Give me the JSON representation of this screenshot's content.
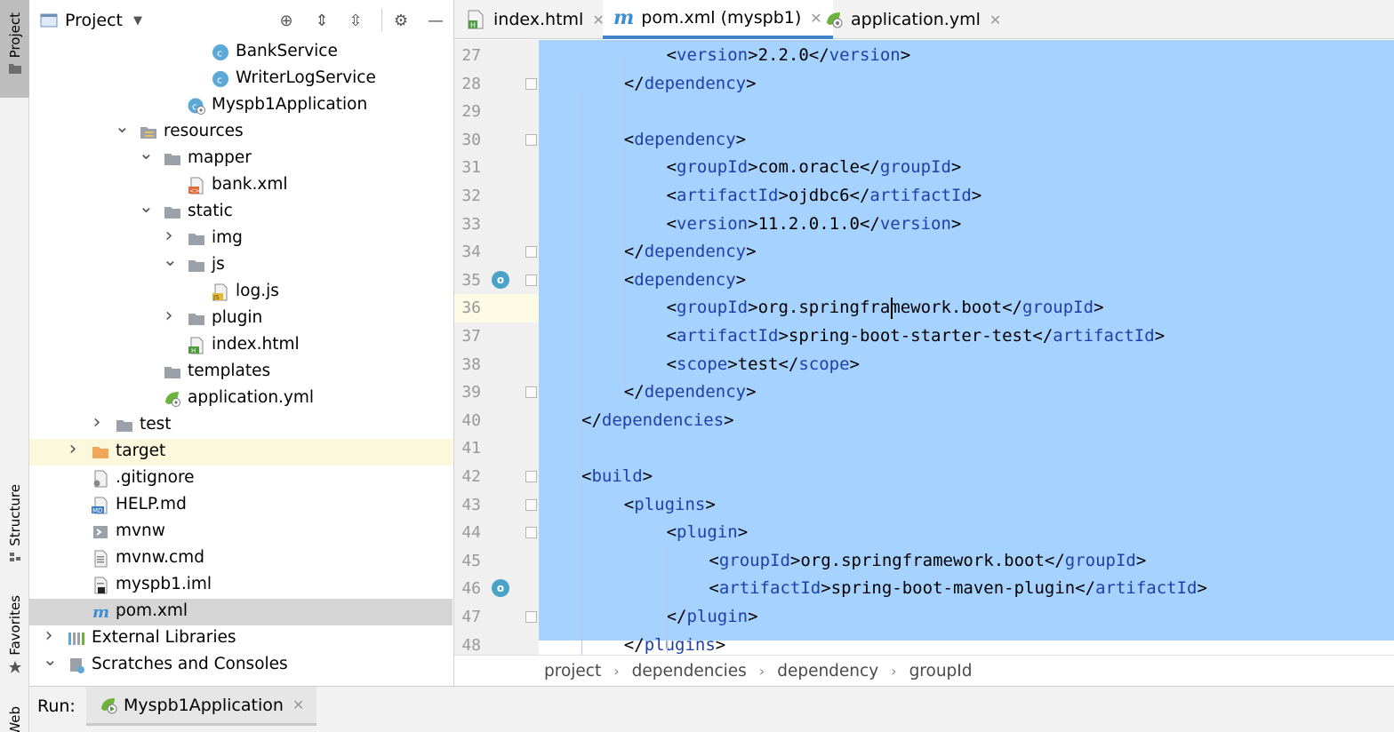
{
  "side_tools": {
    "project": "Project",
    "structure": "Structure",
    "favorites": "Favorites",
    "web": "Web"
  },
  "project_panel": {
    "title": "Project",
    "tree": [
      {
        "label": "BankService",
        "icon": "class-icon",
        "depth": 7,
        "chevron": "none"
      },
      {
        "label": "WriterLogService",
        "icon": "class-icon",
        "depth": 7,
        "chevron": "none"
      },
      {
        "label": "Myspb1Application",
        "icon": "spring-boot-class-icon",
        "depth": 6,
        "chevron": "none"
      },
      {
        "label": "resources",
        "icon": "resources-folder-icon",
        "depth": 4,
        "chevron": "down"
      },
      {
        "label": "mapper",
        "icon": "folder-icon",
        "depth": 5,
        "chevron": "down"
      },
      {
        "label": "bank.xml",
        "icon": "xml-file-icon",
        "depth": 6,
        "chevron": "none"
      },
      {
        "label": "static",
        "icon": "folder-icon",
        "depth": 5,
        "chevron": "down"
      },
      {
        "label": "img",
        "icon": "folder-icon",
        "depth": 6,
        "chevron": "right"
      },
      {
        "label": "js",
        "icon": "folder-icon",
        "depth": 6,
        "chevron": "down"
      },
      {
        "label": "log.js",
        "icon": "js-file-icon",
        "depth": 7,
        "chevron": "none"
      },
      {
        "label": "plugin",
        "icon": "folder-icon",
        "depth": 6,
        "chevron": "right"
      },
      {
        "label": "index.html",
        "icon": "html-file-icon",
        "depth": 6,
        "chevron": "none"
      },
      {
        "label": "templates",
        "icon": "folder-icon",
        "depth": 5,
        "chevron": "none"
      },
      {
        "label": "application.yml",
        "icon": "spring-config-icon",
        "depth": 5,
        "chevron": "none"
      },
      {
        "label": "test",
        "icon": "folder-icon",
        "depth": 3,
        "chevron": "right"
      },
      {
        "label": "target",
        "icon": "excluded-folder-icon",
        "depth": 2,
        "chevron": "right"
      },
      {
        "label": ".gitignore",
        "icon": "gitignore-file-icon",
        "depth": 2,
        "chevron": "none"
      },
      {
        "label": "HELP.md",
        "icon": "markdown-file-icon",
        "depth": 2,
        "chevron": "none"
      },
      {
        "label": "mvnw",
        "icon": "shell-file-icon",
        "depth": 2,
        "chevron": "none"
      },
      {
        "label": "mvnw.cmd",
        "icon": "text-file-icon",
        "depth": 2,
        "chevron": "none"
      },
      {
        "label": "myspb1.iml",
        "icon": "iml-file-icon",
        "depth": 2,
        "chevron": "none"
      },
      {
        "label": "pom.xml",
        "icon": "maven-icon",
        "depth": 2,
        "chevron": "none"
      },
      {
        "label": "External Libraries",
        "icon": "libraries-icon",
        "depth": 1,
        "chevron": "right"
      },
      {
        "label": "Scratches and Consoles",
        "icon": "scratches-icon",
        "depth": 1,
        "chevron": "down"
      }
    ]
  },
  "editor_tabs": [
    {
      "label": "index.html",
      "icon": "html-file-icon",
      "active": false
    },
    {
      "label": "pom.xml (myspb1)",
      "icon": "maven-icon",
      "active": true
    },
    {
      "label": "application.yml",
      "icon": "spring-config-icon",
      "active": false
    }
  ],
  "editor": {
    "lines": [
      {
        "n": "27",
        "indent": 3,
        "text": "<version>2.2.0</version>"
      },
      {
        "n": "28",
        "indent": 2,
        "text": "</dependency>"
      },
      {
        "n": "29",
        "indent": 0,
        "text": ""
      },
      {
        "n": "30",
        "indent": 2,
        "text": "<dependency>"
      },
      {
        "n": "31",
        "indent": 3,
        "text": "<groupId>com.oracle</groupId>"
      },
      {
        "n": "32",
        "indent": 3,
        "text": "<artifactId>ojdbc6</artifactId>"
      },
      {
        "n": "33",
        "indent": 3,
        "text": "<version>11.2.0.1.0</version>"
      },
      {
        "n": "34",
        "indent": 2,
        "text": "</dependency>"
      },
      {
        "n": "35",
        "indent": 2,
        "text": "<dependency>"
      },
      {
        "n": "36",
        "indent": 3,
        "text": "<groupId>org.springframework.boot</groupId>"
      },
      {
        "n": "37",
        "indent": 3,
        "text": "<artifactId>spring-boot-starter-test</artifactId>"
      },
      {
        "n": "38",
        "indent": 3,
        "text": "<scope>test</scope>"
      },
      {
        "n": "39",
        "indent": 2,
        "text": "</dependency>"
      },
      {
        "n": "40",
        "indent": 1,
        "text": "</dependencies>"
      },
      {
        "n": "41",
        "indent": 0,
        "text": ""
      },
      {
        "n": "42",
        "indent": 1,
        "text": "<build>"
      },
      {
        "n": "43",
        "indent": 2,
        "text": "<plugins>"
      },
      {
        "n": "44",
        "indent": 3,
        "text": "<plugin>"
      },
      {
        "n": "45",
        "indent": 4,
        "text": "<groupId>org.springframework.boot</groupId>"
      },
      {
        "n": "46",
        "indent": 4,
        "text": "<artifactId>spring-boot-maven-plugin</artifactId>"
      },
      {
        "n": "47",
        "indent": 3,
        "text": "</plugin>"
      },
      {
        "n": "48",
        "indent": 2,
        "text": "</plugins>"
      }
    ]
  },
  "breadcrumb": [
    "project",
    "dependencies",
    "dependency",
    "groupId"
  ],
  "run_bar": {
    "label": "Run:",
    "config": "Myspb1Application"
  },
  "colors": {
    "selection": "#a6d2ff",
    "tag": "#1f3fa8",
    "accent": "#4083c9"
  }
}
